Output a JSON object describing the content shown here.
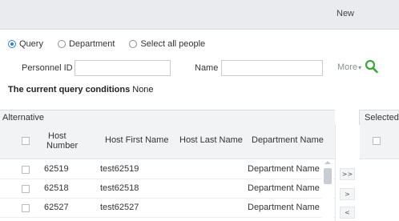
{
  "dialog": {
    "title": "New"
  },
  "query_mode": {
    "options": [
      {
        "label": "Query",
        "selected": true
      },
      {
        "label": "Department",
        "selected": false
      },
      {
        "label": "Select all people",
        "selected": false
      }
    ]
  },
  "filters": {
    "personnel_id_label": "Personnel ID",
    "personnel_id_value": "",
    "name_label": "Name",
    "name_value": "",
    "more_label": "More",
    "more_caret": "▾",
    "search_icon": "search-icon"
  },
  "conditions": {
    "label": "The current query conditions",
    "value": "None"
  },
  "alternative": {
    "title": "Alternative",
    "columns": {
      "host_number_line1": "Host",
      "host_number_line2": "Number",
      "first_name": "Host First Name",
      "last_name": "Host Last Name",
      "department": "Department Name"
    },
    "rows": [
      {
        "host_number": "62519",
        "first_name": "test62519",
        "last_name": "",
        "department": "Department Name"
      },
      {
        "host_number": "62518",
        "first_name": "test62518",
        "last_name": "",
        "department": "Department Name"
      },
      {
        "host_number": "62527",
        "first_name": "test62527",
        "last_name": "",
        "department": "Department Name"
      }
    ]
  },
  "selected": {
    "title": "Selected"
  },
  "transfer": {
    "move_all_right": ">>",
    "move_right": ">",
    "move_left": "<"
  },
  "colors": {
    "accent": "#2d7fd8",
    "search_icon": "#3aa83a",
    "header_bg": "#f2f3f5",
    "topbar_bg": "#e9ebee"
  }
}
